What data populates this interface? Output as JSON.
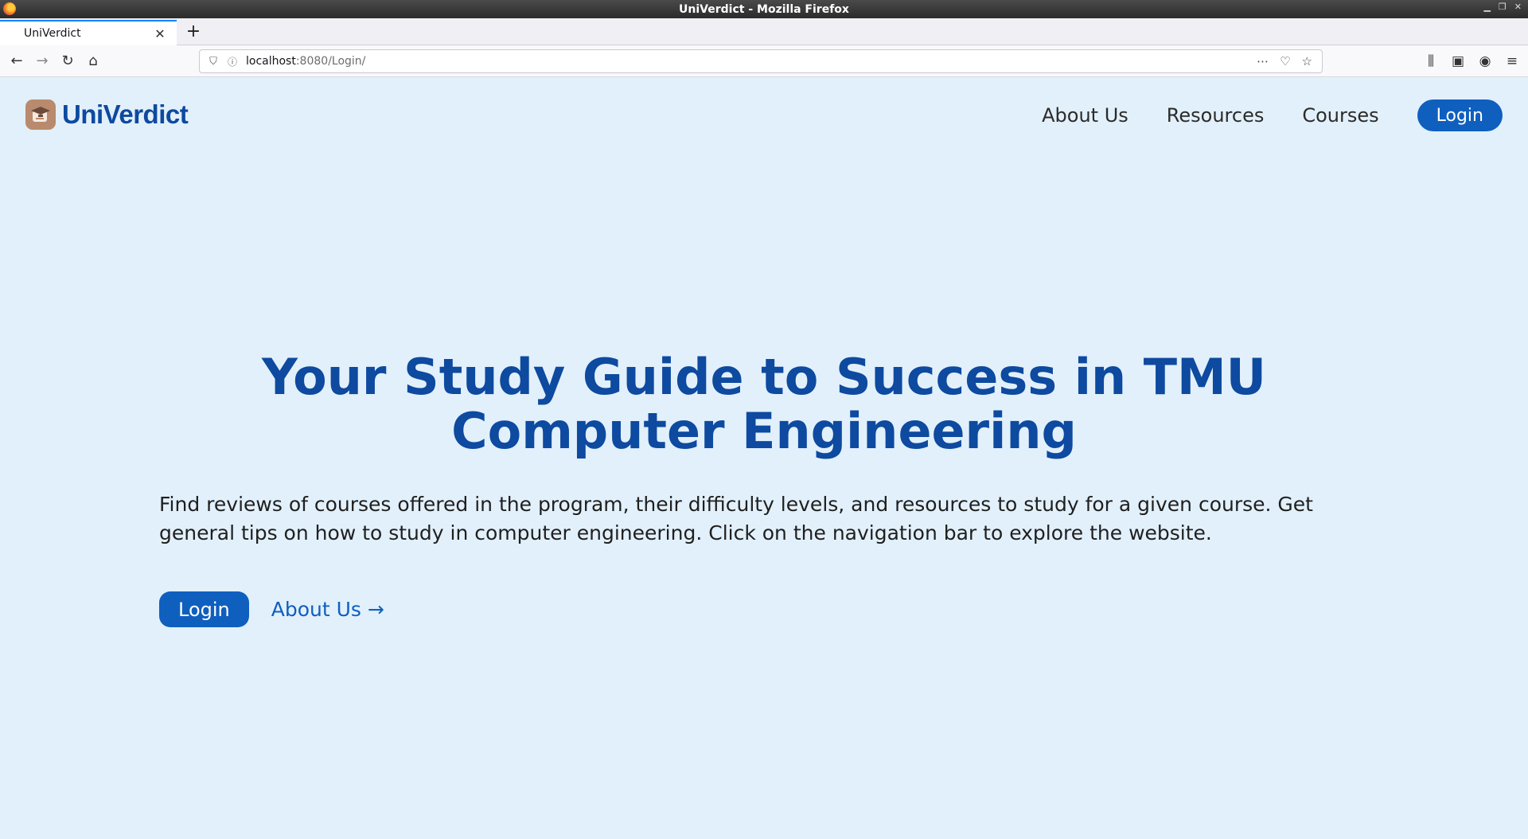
{
  "browser": {
    "window_title": "UniVerdict - Mozilla Firefox",
    "tab_title": "UniVerdict",
    "url_host": "localhost",
    "url_path": ":8080/Login/"
  },
  "site": {
    "brand": "UniVerdict",
    "brand_color": "#0d4aa0",
    "accent_color": "#0f5fbf",
    "background_color": "#e2f0fb",
    "nav": {
      "about": "About Us",
      "resources": "Resources",
      "courses": "Courses",
      "login": "Login"
    }
  },
  "hero": {
    "title": "Your Study Guide to Success in TMU Computer Engineering",
    "description": "Find reviews of courses offered in the program, their difficulty levels, and resources to study for a given course. Get general tips on how to study in computer engineering. Click on the navigation bar to explore the website.",
    "login_button": "Login",
    "about_link": "About Us →"
  }
}
